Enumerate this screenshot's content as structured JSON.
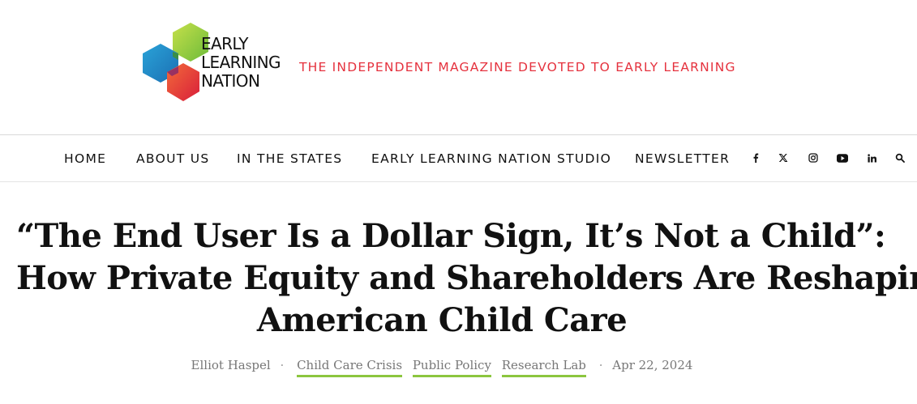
{
  "brand": {
    "logo_lines": [
      "EARLY",
      "LEARNING",
      "NATION"
    ],
    "tagline": "THE INDEPENDENT MAGAZINE DEVOTED TO EARLY LEARNING",
    "colors": {
      "tagline": "#e5323e",
      "hex_green": "#8cc63f",
      "hex_blue": "#1b8fd0",
      "hex_red": "#e5323e"
    }
  },
  "nav": {
    "items": [
      {
        "label": "HOME"
      },
      {
        "label": "ABOUT US"
      },
      {
        "label": "IN THE STATES"
      },
      {
        "label": "EARLY LEARNING NATION STUDIO"
      },
      {
        "label": "NEWSLETTER"
      }
    ],
    "social_icons": [
      "facebook-icon",
      "x-icon",
      "instagram-icon",
      "youtube-icon",
      "linkedin-icon",
      "search-icon"
    ]
  },
  "article": {
    "title_lines": [
      "“The End User Is a Dollar Sign, It’s Not a Child”:",
      "How Private Equity and Shareholders Are Reshaping",
      "American Child Care"
    ],
    "author": "Elliot Haspel",
    "categories": [
      "Child Care Crisis",
      "Public Policy",
      "Research Lab"
    ],
    "date": "Apr 22, 2024",
    "category_underline_color": "#8cc63f"
  }
}
